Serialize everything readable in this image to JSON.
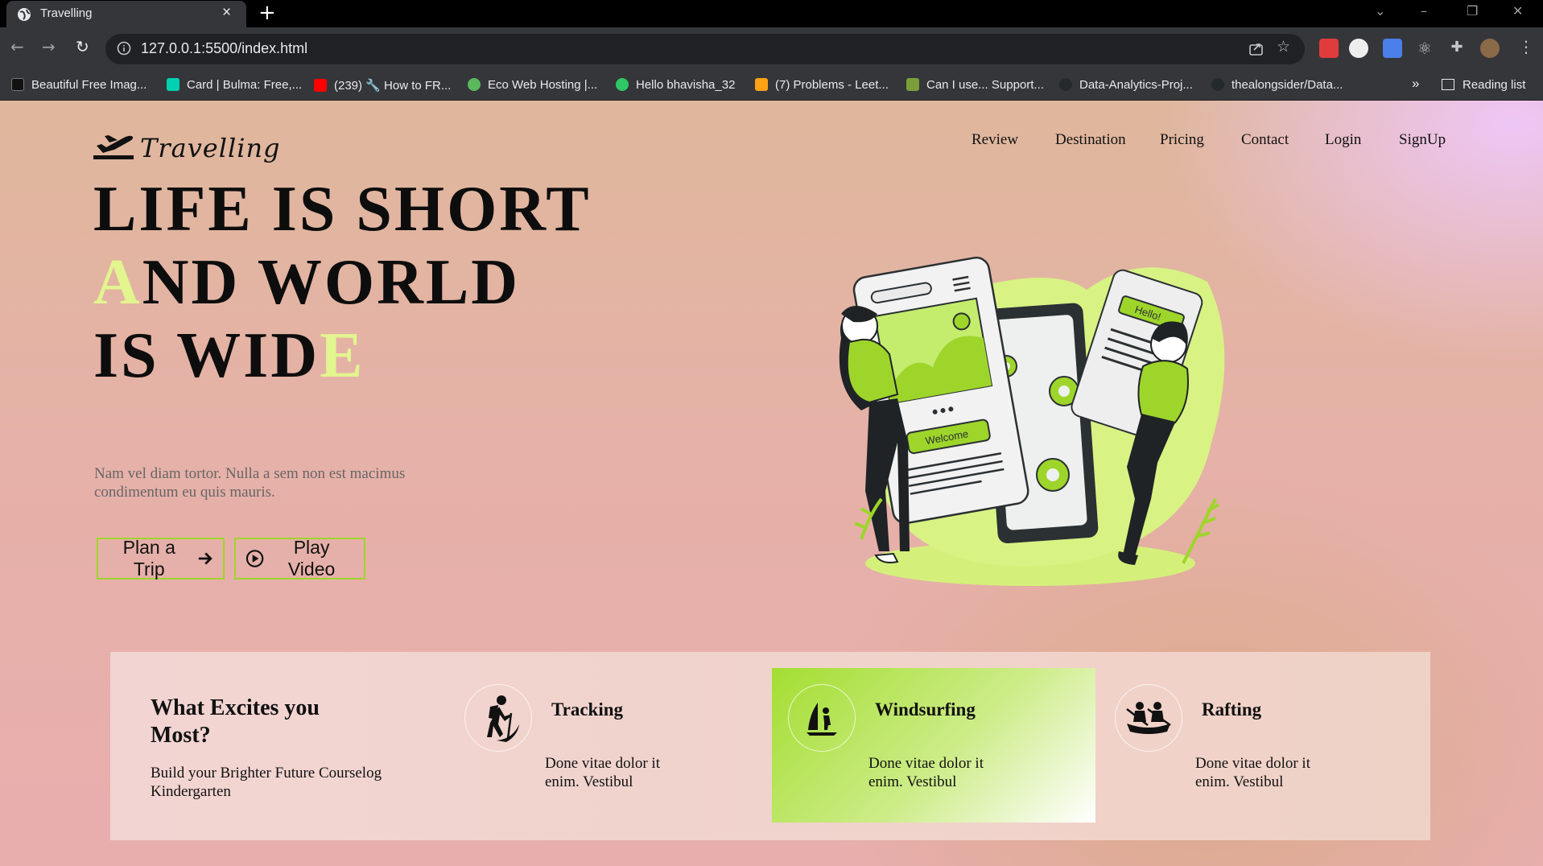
{
  "browser": {
    "tab_title": "Travelling",
    "url": "127.0.0.1:5500/index.html",
    "bookmarks": [
      {
        "label": "Beautiful Free Imag...",
        "color": "#111111"
      },
      {
        "label": "Card | Bulma: Free,...",
        "color": "#00d1b2"
      },
      {
        "label": "(239) 🔧 How to FR...",
        "color": "#ff0000"
      },
      {
        "label": "Eco Web Hosting |...",
        "color": "#5cb85c"
      },
      {
        "label": "Hello bhavisha_32",
        "color": "#2ec866"
      },
      {
        "label": "(7) Problems - Leet...",
        "color": "#ffa116"
      },
      {
        "label": "Can I use... Support...",
        "color": "#7a9e3a"
      },
      {
        "label": "Data-Analytics-Proj...",
        "color": "#24292e"
      },
      {
        "label": "thealongsider/Data...",
        "color": "#24292e"
      }
    ],
    "bookmarks_more": "»",
    "reading_list": "Reading list"
  },
  "site": {
    "logo_text": "Travelling",
    "nav": [
      "Review",
      "Destination",
      "Pricing",
      "Contact",
      "Login",
      "SignUp"
    ]
  },
  "hero": {
    "line1": "LIFE IS SHORT",
    "line2_first": "A",
    "line2_rest": "ND WORLD",
    "line3_main": "IS WID",
    "line3_last": "E",
    "subtitle": "Nam vel diam tortor. Nulla a sem non est macimus condimentum eu quis mauris.",
    "btn_plan": "Plan a Trip",
    "btn_video": "Play Video",
    "accent": "#a4d93a",
    "highlight": "#e2f58f"
  },
  "illustration": {
    "hello": "Hello!",
    "welcome": "Welcome"
  },
  "excites": {
    "title": "What Excites you Most?",
    "text": "Build your Brighter Future Courselog Kindergarten",
    "cards": [
      {
        "title": "Tracking",
        "text": "Done vitae dolor it enim. Vestibul",
        "icon": "hiker-icon",
        "active": false
      },
      {
        "title": "Windsurfing",
        "text": "Done vitae dolor it enim. Vestibul",
        "icon": "windsurf-icon",
        "active": true
      },
      {
        "title": "Rafting",
        "text": "Done vitae dolor it enim. Vestibul",
        "icon": "rafting-icon",
        "active": false
      }
    ]
  }
}
